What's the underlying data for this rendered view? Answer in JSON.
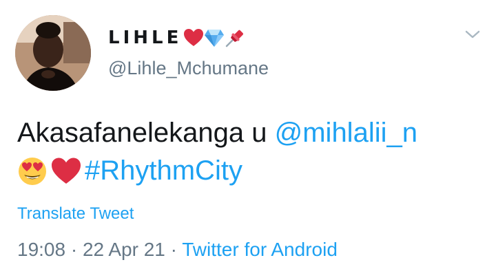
{
  "user": {
    "display_name": "LIHLE",
    "name_emojis": [
      "red-heart",
      "gem",
      "pushpin"
    ],
    "handle": "@Lihle_Mchumane"
  },
  "tweet": {
    "text_before_mention": "Akasafanelekanga u ",
    "mention": "@mihlalii_n",
    "line2_emojis": [
      "smiling-face-with-heart-eyes",
      "red-heart"
    ],
    "hashtag": "#RhythmCity"
  },
  "translate_label": "Translate Tweet",
  "meta": {
    "time": "19:08",
    "separator_1": " · ",
    "date": "22 Apr 21",
    "separator_2": " · ",
    "source": "Twitter for Android"
  },
  "colors": {
    "link": "#1da1f2",
    "secondary_text": "#657786",
    "primary_text": "#14171a",
    "heart": "#dd2e44"
  }
}
